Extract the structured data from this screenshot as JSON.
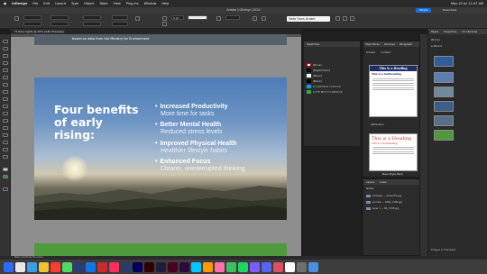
{
  "menubar": {
    "app": "InDesign",
    "items": [
      "File",
      "Edit",
      "Layout",
      "Type",
      "Object",
      "Table",
      "View",
      "Plug-ins",
      "Window",
      "Help"
    ],
    "clock": "Mon 22 Jul 11:07 AM"
  },
  "window": {
    "title": "Adobe InDesign 2024",
    "share_label": "Share",
    "workspace": "Essentials"
  },
  "control_bar": {
    "font": "Noto Sans Arabic",
    "stroke": "0 pt"
  },
  "document_tab": "*2 Rise Lights @ 25% [GPU Preview]",
  "page1": {
    "caption": "based on data from the Ministry for Environment"
  },
  "slide": {
    "headline": "Four benefits of early rising:",
    "benefits": [
      {
        "title": "Increased Productivity",
        "subtitle": "More time for tasks"
      },
      {
        "title": "Better Mental Health",
        "subtitle": "Reduced stress levels"
      },
      {
        "title": "Improved Physical Health",
        "subtitle": "Healthier lifestyle habits"
      },
      {
        "title": "Enhanced Focus",
        "subtitle": "Clearer, uninterrupted thinking"
      }
    ]
  },
  "swatches": {
    "title": "Swatches",
    "items": [
      {
        "name": "[None]",
        "color": "#ffffff"
      },
      {
        "name": "[Registration]",
        "color": "#000000"
      },
      {
        "name": "[Paper]",
        "color": "#ffffff"
      },
      {
        "name": "[Black]",
        "color": "#000000"
      },
      {
        "name": "C=100 M=0 Y=0 K=0",
        "color": "#00a0e9"
      },
      {
        "name": "C=75 M=5 Y=100 K=0",
        "color": "#3aa935"
      }
    ]
  },
  "styles_panel": {
    "tabs": [
      "Style Packs",
      "Libraries",
      "Paragraph"
    ],
    "subtabs": [
      "Presets",
      "Content"
    ],
    "preview1_heading": "This is a Heading",
    "preview1_sub": "This is a Subheading",
    "attribution_label": "Attribution",
    "preview2_heading": "This is a Heading",
    "preview2_sub": "This is a Subheading",
    "new_style_label": "New Style Pack"
  },
  "layers_panel": {
    "tabs": [
      "Layers",
      "Links"
    ],
    "name_header": "Name",
    "items": [
      "enlarger — visual file.jpg",
      "sunrise — 1000_1300.jpg",
      "layer 1 — B1_3745.jpg"
    ]
  },
  "pages_panel": {
    "tabs": [
      "Pages",
      "Properties",
      "CC Libraries"
    ],
    "none_label": "[None]",
    "a_master": "A-Parent",
    "status": "8 Pages in 8 Spreads"
  },
  "statusbar": {
    "text": "Basic (working)   No errors"
  },
  "dock": {
    "colors": [
      "#2a6df4",
      "#e8e8e8",
      "#3a9fe8",
      "#f2c230",
      "#ff3b30",
      "#4cd964",
      "#2a3b7a",
      "#1473e6",
      "#c92a2a",
      "#ff2b5e",
      "#2a3d68",
      "#00005b",
      "#330000",
      "#1f1f3d",
      "#49021f",
      "#2b0a3d",
      "#00c8ff",
      "#ff9a00",
      "#ff6fb0",
      "#3fbf5f",
      "#1ed760",
      "#7a5cff",
      "#5865f2",
      "#e04f5f",
      "#ffffff",
      "#6e6e6e",
      "#4a90e2"
    ]
  }
}
